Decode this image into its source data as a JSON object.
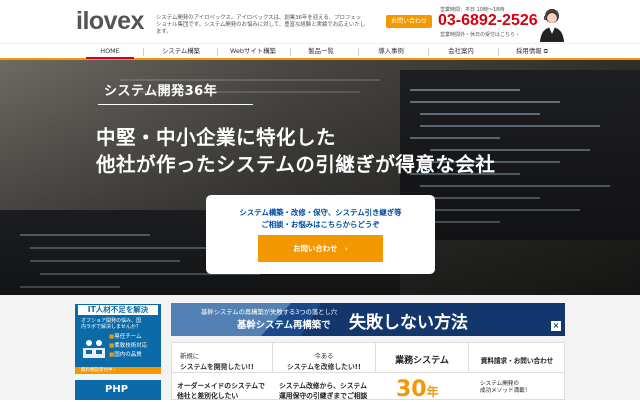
{
  "header": {
    "logo_text": "ilovex",
    "tagline": "システム開発のアイロベックス。アイロベックスは、創業36年を迎える、プロフェッショナル集団です。システム開発のお悩みに対して、豊富な経験と実績でお応えいたします。",
    "contact_button": "お問い合わせ",
    "hours_top": "営業時間：平日 10時〜18時",
    "phone": "03-6892-2526",
    "hours_bottom": "営業時間外・休日の受付はこちら ›"
  },
  "nav": {
    "items": [
      {
        "label": "HOME"
      },
      {
        "label": "システム構築"
      },
      {
        "label": "Webサイト構築"
      },
      {
        "label": "製品一覧"
      },
      {
        "label": "導入事例"
      },
      {
        "label": "会社案内"
      },
      {
        "label": "採用情報"
      }
    ]
  },
  "hero": {
    "badge": "システム開発36年",
    "headline_1": "中堅・中小企業に特化した",
    "headline_2": "他社が作ったシステムの引継ぎが得意な会社",
    "box_line_1": "システム構築・改修・保守、システム引き継ぎ等",
    "box_line_2": "ご相談・お悩みはこちらからどうぞ",
    "box_button": "お問い合わせ　›"
  },
  "sidebar": {
    "it_title": "IT人材不足を解決",
    "it_sub": "オフショア開発の悩み、国内ラボで解決しませんか？",
    "it_items": [
      "専任チーム",
      "柔軟技術対応",
      "国内の品質"
    ],
    "it_footer": "無料相談受付中 ›",
    "php_label": "PHP"
  },
  "banner": {
    "line_1": "基幹システムの再構築が失敗する3つの落とし穴",
    "line_2": "基幹システム再構築で",
    "line_3": "失敗しない方法"
  },
  "cards": {
    "new": {
      "h1": "新規に",
      "h2": "システムを開発したい!!",
      "body_1": "オーダーメイドのシステムで",
      "body_2": "他社と差別化したい"
    },
    "existing": {
      "h1": "今ある",
      "h2": "システムを改修したい!!",
      "body_1": "システム改修から、システム",
      "body_2": "運用保守の引継ぎまでご相談"
    },
    "business": {
      "title": "業務システム",
      "number": "30",
      "unit": "年"
    },
    "docs": {
      "title": "資料請求・お問い合わせ",
      "body_1": "システム開発の",
      "body_2": "成功メソッド満載！"
    }
  },
  "colors": {
    "accent": "#f39800",
    "brand_blue": "#0b6aa8",
    "phone_red": "#d7000f",
    "navy": "#143a73"
  }
}
